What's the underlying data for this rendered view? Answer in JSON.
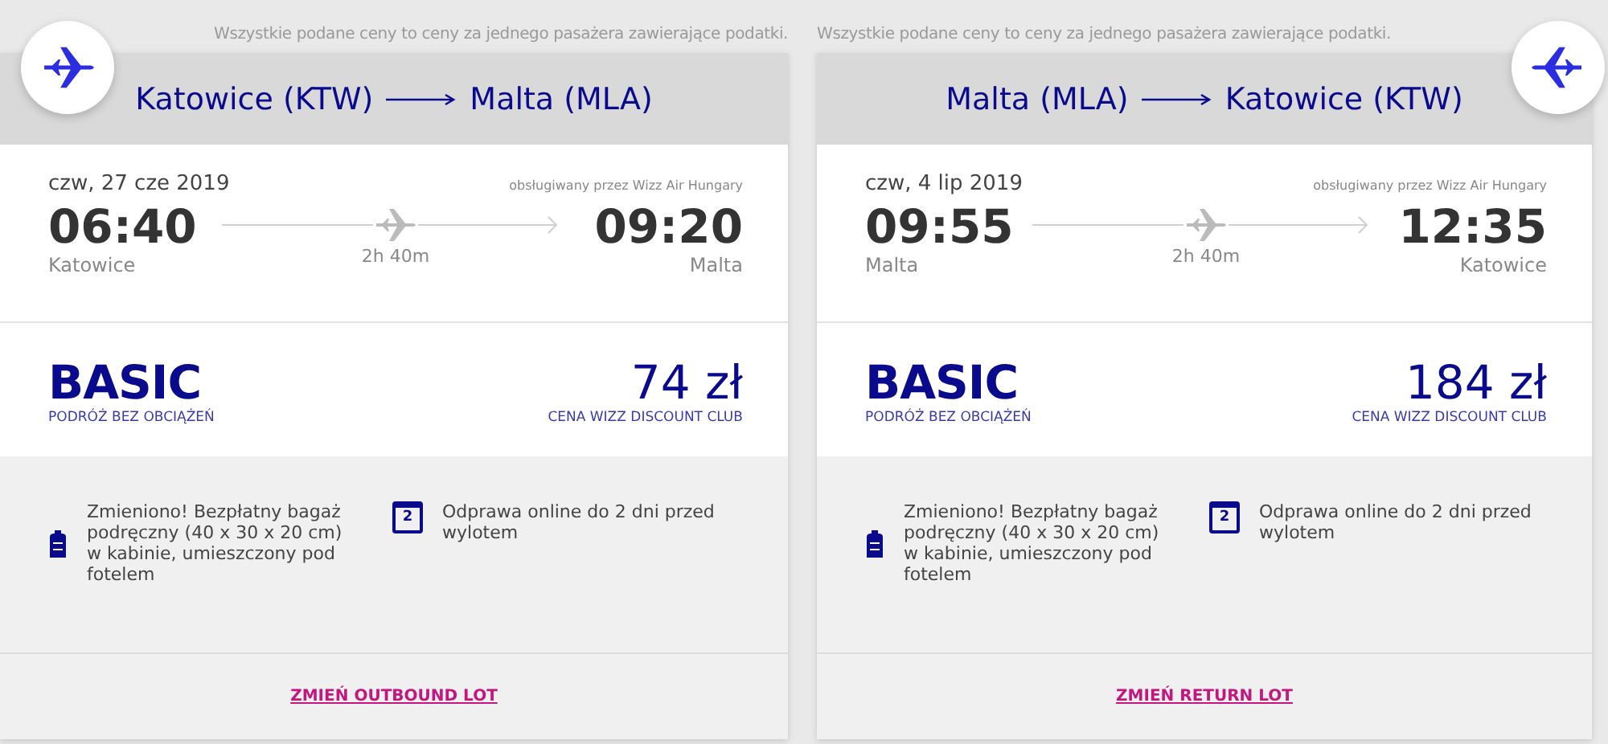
{
  "notice_left": "Wszystkie podane ceny to ceny za jednego pasażera zawierające podatki.",
  "notice_right": "Wszystkie podane ceny to ceny za jednego pasażera zawierające podatki.",
  "flights": [
    {
      "kind": "outbound",
      "from": "Katowice (KTW)",
      "to": "Malta (MLA)",
      "date": "czw, 27 cze 2019",
      "operator": "obsługiwany przez Wizz Air Hungary",
      "departure_time": "06:40",
      "departure_city": "Katowice",
      "duration": "2h 40m",
      "arrival_time": "09:20",
      "arrival_city": "Malta",
      "fare": "BASIC",
      "fare_subtitle": "PODRÓŻ BEZ OBCIĄŻEŃ",
      "price": "74 zł",
      "price_label": "CENA WIZZ DISCOUNT CLUB",
      "features": [
        {
          "kind": "bag",
          "text": "Zmieniono! Bezpłatny bagaż podręczny (40 x 30 x 20 cm) w kabinie, umieszczony pod fotelem"
        },
        {
          "kind": "calendar",
          "icon_text": "2",
          "text": "Odprawa online do 2 dni przed wylotem"
        }
      ],
      "change_link": "ZMIEŃ OUTBOUND LOT"
    },
    {
      "kind": "return",
      "from": "Malta (MLA)",
      "to": "Katowice (KTW)",
      "date": "czw, 4 lip 2019",
      "operator": "obsługiwany przez Wizz Air Hungary",
      "departure_time": "09:55",
      "departure_city": "Malta",
      "duration": "2h 40m",
      "arrival_time": "12:35",
      "arrival_city": "Katowice",
      "fare": "BASIC",
      "fare_subtitle": "PODRÓŻ BEZ OBCIĄŻEŃ",
      "price": "184 zł",
      "price_label": "CENA WIZZ DISCOUNT CLUB",
      "features": [
        {
          "kind": "bag",
          "text": "Zmieniono! Bezpłatny bagaż podręczny (40 x 30 x 20 cm) w kabinie, umieszczony pod fotelem"
        },
        {
          "kind": "calendar",
          "icon_text": "2",
          "text": "Odprawa online do 2 dni przed wylotem"
        }
      ],
      "change_link": "ZMIEŃ RETURN LOT"
    }
  ]
}
